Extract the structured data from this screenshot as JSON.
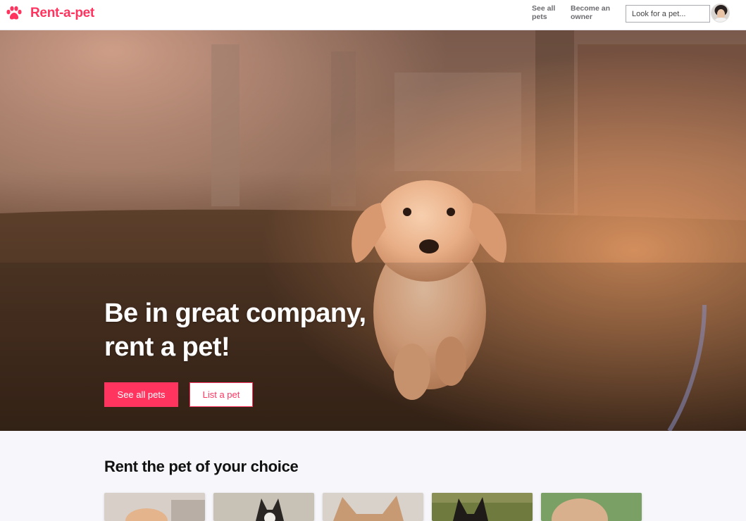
{
  "brand": {
    "name": "Rent-a-pet",
    "color": "#ff3560",
    "icon": "paw-icon"
  },
  "nav": {
    "links": [
      {
        "label": "See all pets"
      },
      {
        "label": "Become an owner"
      }
    ],
    "search": {
      "placeholder": "Look for a pet...",
      "value": ""
    },
    "avatar": "user-avatar"
  },
  "hero": {
    "title_line1": "Be in great company,",
    "title_line2": "rent a pet!",
    "primary_button": "See all pets",
    "secondary_button": "List a pet",
    "image": "golden-retriever-puppy-running-on-grass"
  },
  "section": {
    "title": "Rent the pet of your choice",
    "cards": [
      {
        "image": "pet-photo-1"
      },
      {
        "image": "pet-photo-dog"
      },
      {
        "image": "pet-photo-cat"
      },
      {
        "image": "pet-photo-horse"
      },
      {
        "image": "pet-photo-rabbit"
      }
    ]
  },
  "colors": {
    "accent": "#ff3560",
    "page_bg": "#f6f6fb"
  }
}
